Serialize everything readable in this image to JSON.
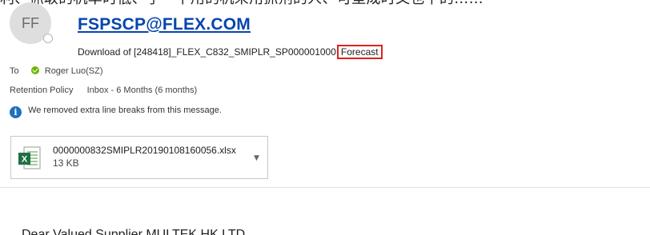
{
  "header": {
    "cut_off_top_text": "利、抓取的机率时低、手一下用的机来用抓剂的人、可型成时又也下的……",
    "avatar_initials": "FF",
    "sender": "FSPSCP@FLEX.COM",
    "subject": "Download of [248418]_FLEX_C832_SMIPLR_SP000001000",
    "subject_highlight": "Forecast"
  },
  "recipients": {
    "to_label": "To",
    "to_name": "Roger Luo(SZ)"
  },
  "retention": {
    "label": "Retention Policy",
    "value": "Inbox - 6 Months (6 months)"
  },
  "info": {
    "message": "We removed extra line breaks from this message."
  },
  "attachment": {
    "filename": "0000000832SMIPLR20190108160056.xlsx",
    "size": "13 KB"
  },
  "body": {
    "cut_off_line": "Dear Valued Supplier MULTEK HK LTD"
  },
  "colors": {
    "link": "#0645ad",
    "highlight_border": "#e02020",
    "presence_check": "#6bb700",
    "info_icon": "#1f6fbf",
    "excel_green": "#1e7145"
  }
}
